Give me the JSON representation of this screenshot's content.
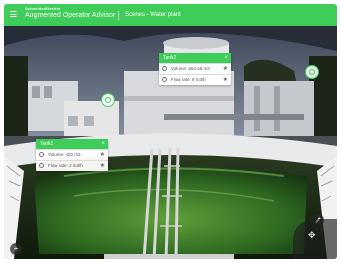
{
  "header": {
    "brand": "SchneiderElectric",
    "app_title": "Augmented Operator Advisor",
    "breadcrumb": "Scenes - Water plant",
    "accent_color": "#3dcd58"
  },
  "cards": [
    {
      "title": "Tank2",
      "rows": [
        {
          "label": "Volume: 654.59 m3",
          "icon": "gauge-icon"
        },
        {
          "label": "Flow rate: 8 m3/h",
          "icon": "flow-icon"
        }
      ]
    },
    {
      "title": "Tank1",
      "rows": [
        {
          "label": "Volume: 420 m3",
          "icon": "gauge-icon"
        },
        {
          "label": "Flow rate: 2 m3/h",
          "icon": "flow-icon"
        }
      ]
    }
  ],
  "icons": {
    "menu": "hamburger-menu-icon",
    "close": "close-icon",
    "favorite": "star-icon",
    "hotspot": "target-icon",
    "add": "plus-icon",
    "edit": "pencil-icon",
    "move": "move-icon"
  }
}
